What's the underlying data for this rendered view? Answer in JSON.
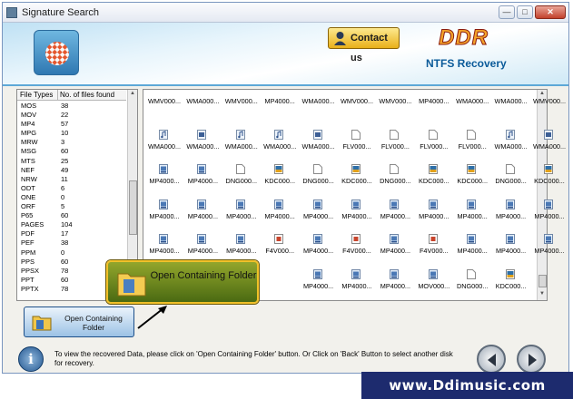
{
  "window": {
    "title": "Signature Search"
  },
  "header": {
    "contact_label": "Contact us",
    "brand": "DDR",
    "subtitle": "NTFS Recovery"
  },
  "file_types": {
    "headers": [
      "File Types",
      "No. of files found"
    ],
    "rows": [
      [
        "MOS",
        "38"
      ],
      [
        "MOV",
        "22"
      ],
      [
        "MP4",
        "57"
      ],
      [
        "MPG",
        "10"
      ],
      [
        "MRW",
        "3"
      ],
      [
        "MSG",
        "60"
      ],
      [
        "MTS",
        "25"
      ],
      [
        "NEF",
        "49"
      ],
      [
        "NRW",
        "11"
      ],
      [
        "ODT",
        "6"
      ],
      [
        "ONE",
        "0"
      ],
      [
        "ORF",
        "5"
      ],
      [
        "P65",
        "60"
      ],
      [
        "PAGES",
        "104"
      ],
      [
        "PDF",
        "17"
      ],
      [
        "PEF",
        "38"
      ],
      [
        "PPM",
        "0"
      ],
      [
        "PPS",
        "60"
      ],
      [
        "PPSX",
        "78"
      ],
      [
        "PPT",
        "60"
      ],
      [
        "PPTX",
        "78"
      ]
    ]
  },
  "files": {
    "rows": [
      {
        "names": [
          "WMV000...",
          "WMA000...",
          "WMV000...",
          "MP4000...",
          "WMA000...",
          "WMV000...",
          "WMV000...",
          "MP4000...",
          "WMA000...",
          "WMA000...",
          "WMV000..."
        ],
        "icons": [
          "none",
          "none",
          "none",
          "none",
          "none",
          "none",
          "none",
          "none",
          "none",
          "none",
          "none"
        ]
      },
      {
        "names": [
          "WMA000...",
          "WMA000...",
          "WMA000...",
          "WMA000...",
          "WMA000...",
          "FLV000...",
          "FLV000...",
          "FLV000...",
          "FLV000...",
          "WMA000...",
          "WMA000..."
        ],
        "icons": [
          "audio",
          "video",
          "audio",
          "audio",
          "video",
          "doc",
          "doc",
          "doc",
          "doc",
          "audio",
          "video"
        ]
      },
      {
        "names": [
          "MP4000...",
          "MP4000...",
          "DNG000...",
          "KDC000...",
          "DNG000...",
          "KDC000...",
          "DNG000...",
          "KDC000...",
          "KDC000...",
          "DNG000...",
          "KDC000..."
        ],
        "icons": [
          "media",
          "media",
          "doc",
          "image",
          "doc",
          "image",
          "doc",
          "image",
          "image",
          "doc",
          "image"
        ]
      },
      {
        "names": [
          "MP4000...",
          "MP4000...",
          "MP4000...",
          "MP4000...",
          "MP4000...",
          "MP4000...",
          "MP4000...",
          "MP4000...",
          "MP4000...",
          "MP4000...",
          "MP4000..."
        ],
        "icons": [
          "media",
          "media",
          "media",
          "media",
          "media",
          "media",
          "media",
          "media",
          "media",
          "media",
          "media"
        ]
      },
      {
        "names": [
          "MP4000...",
          "MP4000...",
          "MP4000...",
          "F4V000...",
          "MP4000...",
          "F4V000...",
          "MP4000...",
          "F4V000...",
          "MP4000...",
          "MP4000...",
          "MP4000..."
        ],
        "icons": [
          "media",
          "media",
          "media",
          "flash",
          "media",
          "flash",
          "media",
          "flash",
          "media",
          "media",
          "media"
        ]
      },
      {
        "names": [
          "",
          "",
          "",
          "",
          "MP4000...",
          "MP4000...",
          "MP4000...",
          "MOV000...",
          "DNG000...",
          "KDC000..."
        ],
        "icons": [
          "",
          "",
          "",
          "",
          "media",
          "media",
          "media",
          "media",
          "doc",
          "image"
        ]
      }
    ]
  },
  "buttons": {
    "open_folder": "Open Containing Folder",
    "callout": "Open Containing Folder"
  },
  "status": {
    "text": "To view the recovered Data, please click on 'Open Containing Folder' button. Or Click on 'Back' Button to select another disk for recovery."
  },
  "banner": {
    "text": "www.Ddimusic.com"
  },
  "colors": {
    "brand_orange": "#f4a32a",
    "accent_blue": "#0a5a99",
    "banner_bg": "#1d2b6e"
  }
}
